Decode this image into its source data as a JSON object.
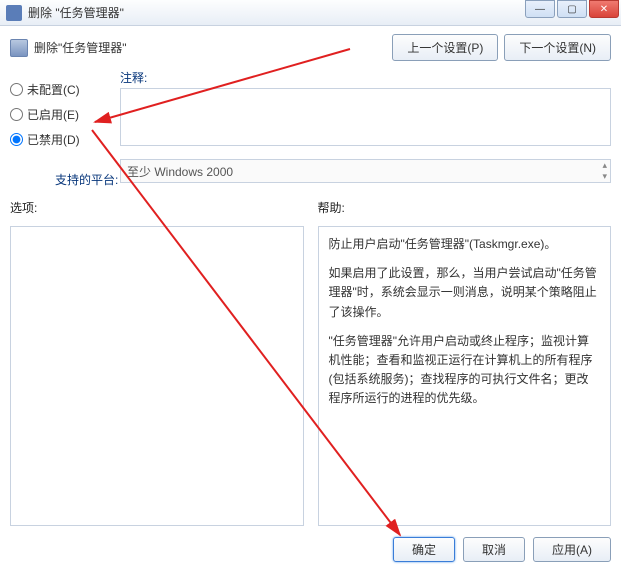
{
  "window": {
    "title": "删除 \"任务管理器\""
  },
  "header": {
    "policy_title": "删除\"任务管理器\"",
    "prev_setting": "上一个设置(P)",
    "next_setting": "下一个设置(N)"
  },
  "radios": {
    "not_configured": "未配置(C)",
    "enabled": "已启用(E)",
    "disabled": "已禁用(D)"
  },
  "labels": {
    "comment": "注释:",
    "platform": "支持的平台:",
    "options": "选项:",
    "help": "帮助:"
  },
  "platform_text": "至少 Windows 2000",
  "help": {
    "p1": "防止用户启动\"任务管理器\"(Taskmgr.exe)。",
    "p2": "如果启用了此设置，那么，当用户尝试启动\"任务管理器\"时，系统会显示一则消息，说明某个策略阻止了该操作。",
    "p3": "\"任务管理器\"允许用户启动或终止程序；监视计算机性能；查看和监视正运行在计算机上的所有程序(包括系统服务)；查找程序的可执行文件名；更改程序所运行的进程的优先级。"
  },
  "footer": {
    "ok": "确定",
    "cancel": "取消",
    "apply": "应用(A)"
  }
}
